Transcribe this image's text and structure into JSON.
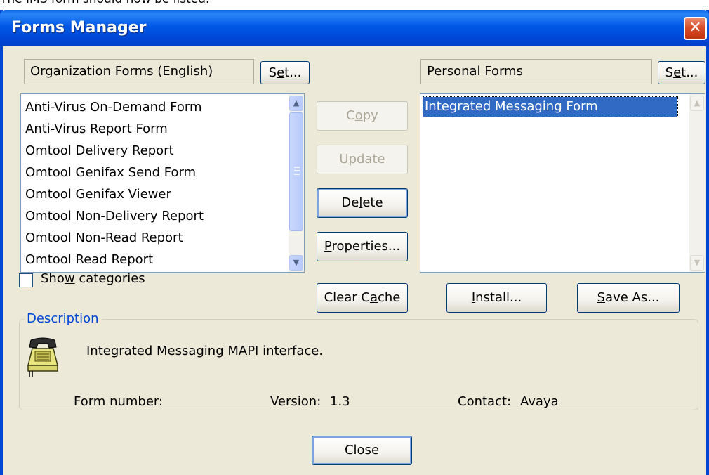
{
  "caption": "The IMS form should now be listed.",
  "window": {
    "title": "Forms Manager",
    "close_glyph": "✕"
  },
  "left_panel": {
    "header": "Organization Forms (English)",
    "set_button": {
      "pre": "S",
      "u": "e",
      "post": "t..."
    },
    "items": [
      "Anti-Virus On-Demand Form",
      "Anti-Virus Report Form",
      "Omtool Delivery Report",
      "Omtool Genifax Send Form",
      "Omtool Genifax Viewer",
      "Omtool Non-Delivery Report",
      "Omtool Non-Read Report",
      "Omtool Read Report"
    ]
  },
  "right_panel": {
    "header": "Personal Forms",
    "set_button": {
      "pre": "S",
      "u": "e",
      "post": "t..."
    },
    "items": [
      "Integrated Messaging Form"
    ],
    "selected_index": 0
  },
  "middle_buttons": {
    "copy": {
      "pre": "C",
      "u": "o",
      "post": "py",
      "enabled": false
    },
    "update": {
      "pre": "",
      "u": "U",
      "post": "pdate",
      "enabled": false
    },
    "delete": {
      "pre": "De",
      "u": "l",
      "post": "ete",
      "enabled": true
    },
    "properties": {
      "pre": "",
      "u": "P",
      "post": "roperties...",
      "enabled": true
    },
    "clear_cache": {
      "pre": "Clear C",
      "u": "a",
      "post": "che",
      "enabled": true
    }
  },
  "show_categories": {
    "pre": "Sho",
    "u": "w",
    "post": " categories",
    "checked": false
  },
  "install_button": {
    "pre": "",
    "u": "I",
    "post": "nstall..."
  },
  "save_as_button": {
    "pre": "",
    "u": "S",
    "post": "ave As..."
  },
  "description": {
    "legend": "Description",
    "icon": "telephone-icon",
    "text": "Integrated Messaging MAPI interface.",
    "form_number_label": "Form number:",
    "form_number_value": "",
    "version_label": "Version:",
    "version_value": "1.3",
    "contact_label": "Contact:",
    "contact_value": "Avaya"
  },
  "close_button": {
    "pre": "",
    "u": "C",
    "post": "lose"
  },
  "colors": {
    "titlebar": "#0058e6",
    "selection": "#316ac5",
    "dialog_bg": "#ece9d8",
    "legend": "#0046d5"
  }
}
